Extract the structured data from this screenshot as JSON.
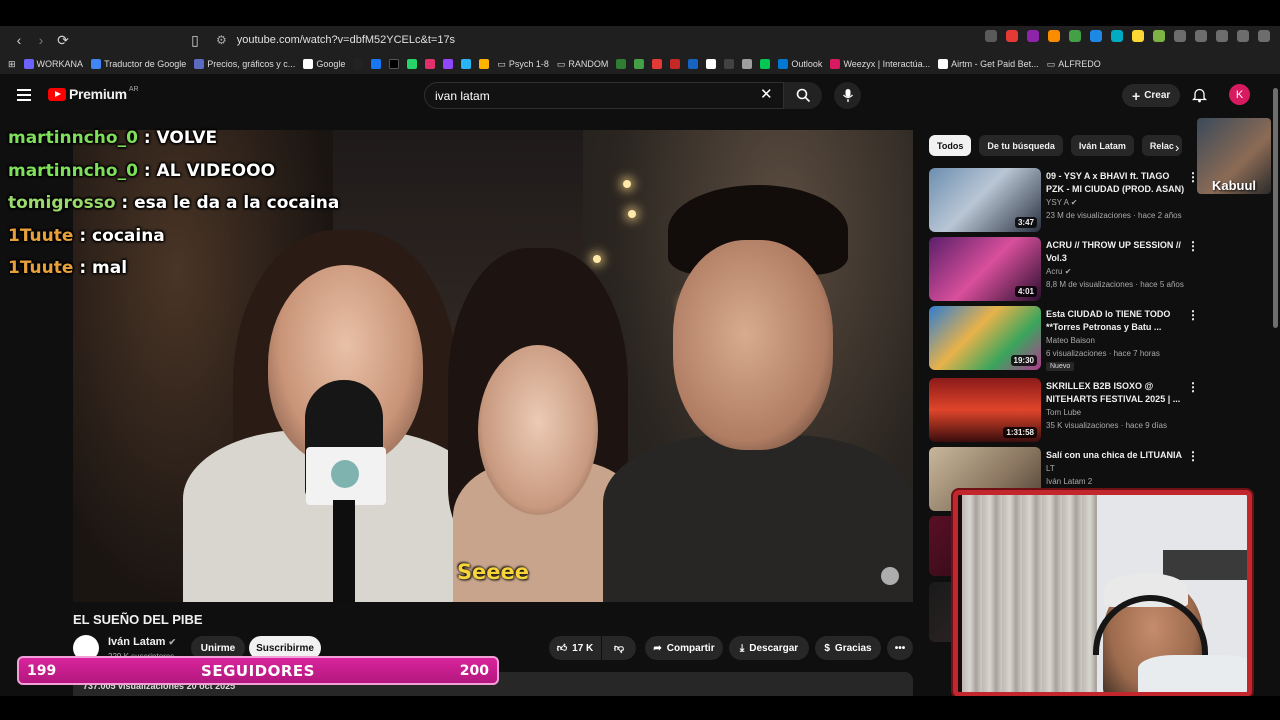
{
  "browser": {
    "url": "youtube.com/watch?v=dbfM52YCELc&t=17s",
    "bookmarks": [
      "WORKANA",
      "Traductor de Google",
      "Precios, gráficos y c...",
      "Google",
      "Psych 1-8",
      "RANDOM",
      "Outlook",
      "Weezyx | Interactúa...",
      "Airtm - Get Paid Bet...",
      "ALFREDO"
    ]
  },
  "header": {
    "logo": "Premium",
    "region": "AR",
    "search_value": "ivan latam",
    "create_label": "Crear",
    "avatar_letter": "K"
  },
  "chat": [
    {
      "user": "martinncho_0",
      "msg": ": VOLVE",
      "color": "#7ee05a"
    },
    {
      "user": "martinncho_0",
      "msg": ": AL VIDEOOO",
      "color": "#7ee05a"
    },
    {
      "user": "tomigrosso",
      "msg": ": esa le da a la cocaina",
      "color": "#9ad96b"
    },
    {
      "user": "1Tuute",
      "msg": ": cocaina",
      "color": "#e8a03a"
    },
    {
      "user": "1Tuute",
      "msg": ": mal",
      "color": "#e8a03a"
    }
  ],
  "video": {
    "subtitle": "Seeee",
    "title": "EL SUEÑO DEL PIBE",
    "channel": "Iván Latam",
    "subs": "229 K suscriptores",
    "join_label": "Unirme",
    "subscribe_label": "Suscribirme",
    "likes": "17 K",
    "share_label": "Compartir",
    "download_label": "Descargar",
    "thanks_label": "Gracias",
    "description": "737.005 visualizaciones  20 oct 2025"
  },
  "chips": [
    "Todos",
    "De tu búsqueda",
    "Iván Latam",
    "Relac"
  ],
  "related": [
    {
      "title": "09 - YSY A x BHAVI ft. TIAGO PZK - MI CIUDAD (PROD. ASAN)",
      "channel": "YSY A",
      "meta": "23 M de visualizaciones · hace 2 años",
      "duration": "3:47"
    },
    {
      "title": "ACRU // THROW UP SESSION // Vol.3",
      "channel": "Acru",
      "meta": "8,8 M de visualizaciones · hace 5 años",
      "duration": "4:01"
    },
    {
      "title": "Esta CIUDAD lo TIENE TODO **Torres Petronas y Batu ...",
      "channel": "Mateo Baison",
      "meta": "6 visualizaciones · hace 7 horas",
      "duration": "19:30",
      "badge": "Nuevo"
    },
    {
      "title": "SKRILLEX B2B ISOXO @ NITEHARTS FESTIVAL 2025 | ...",
      "channel": "Tom Lube",
      "meta": "35 K visualizaciones · hace 9 días",
      "duration": "1:31:58"
    },
    {
      "title": "Salí con una chica de LITUANIA",
      "channel": "Iván Latam 2",
      "meta": "",
      "duration": ""
    }
  ],
  "overlay": {
    "cam_name": "Kabuul",
    "followers_current": "199",
    "followers_label": "SEGUIDORES",
    "followers_goal": "200",
    "followers_progress": 0.995
  },
  "colors": {
    "accent": "#ff0000",
    "goal_bar": "#d8249b",
    "cam_border": "#c2272d"
  }
}
